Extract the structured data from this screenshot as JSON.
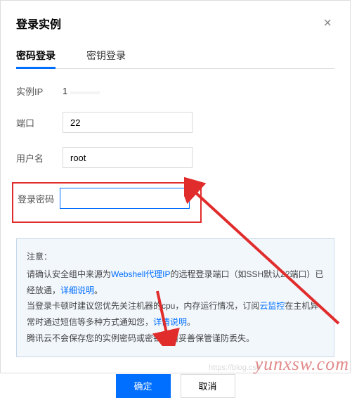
{
  "dialog": {
    "title": "登录实例",
    "close_glyph": "×"
  },
  "tabs": {
    "password": "密码登录",
    "key": "密钥登录"
  },
  "form": {
    "ip_label": "实例IP",
    "ip_prefix": "1",
    "ip_masked": " ",
    "port_label": "端口",
    "port_value": "22",
    "user_label": "用户名",
    "user_value": "root",
    "password_label": "登录密码",
    "password_value": ""
  },
  "notice": {
    "title": "注意：",
    "line1_a": "请确认安全组中来源为",
    "line1_link": "Webshell代理IP",
    "line1_b": "的远程登录端口（如SSH默认22端口）已经放通，",
    "line1_link2": "详细说明",
    "line1_c": "。",
    "line2_a": "当登录卡顿时建议您优先关注机器的cpu，内存运行情况，订阅",
    "line2_link": "云监控",
    "line2_b": "在主机异常时通过短信等多种方式通知您，",
    "line2_link2": "详情说明",
    "line2_c": "。",
    "line3": "腾讯云不会保存您的实例密码或密钥，请妥善保管谨防丢失。"
  },
  "buttons": {
    "ok": "确定",
    "cancel": "取消"
  },
  "watermark": {
    "main": "yunxsw.com",
    "faint": "https://blog.csd"
  },
  "colors": {
    "primary": "#006eff",
    "highlight": "#e12c2c"
  }
}
